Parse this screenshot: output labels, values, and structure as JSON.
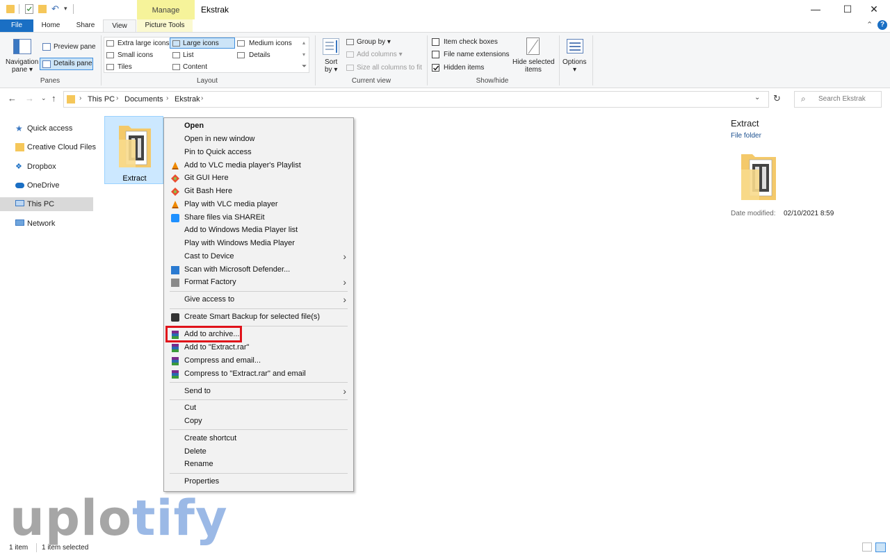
{
  "window": {
    "title": "Ekstrak",
    "context_tab": "Manage",
    "minimize": "—",
    "maximize": "☐",
    "close": "✕"
  },
  "tabs": {
    "file": "File",
    "home": "Home",
    "share": "Share",
    "view": "View",
    "picture_tools": "Picture Tools"
  },
  "ribbon": {
    "panes": {
      "navigation_pane": "Navigation",
      "navigation_pane_2": "pane ▾",
      "preview_pane": "Preview pane",
      "details_pane": "Details pane",
      "label": "Panes"
    },
    "layout": {
      "extra_large_icons": "Extra large icons",
      "large_icons": "Large icons",
      "medium_icons": "Medium icons",
      "small_icons": "Small icons",
      "list": "List",
      "details": "Details",
      "tiles": "Tiles",
      "content": "Content",
      "label": "Layout"
    },
    "current_view": {
      "sort_by": "Sort",
      "sort_by_2": "by ▾",
      "group_by": "Group by ▾",
      "add_columns": "Add columns ▾",
      "size_all_columns": "Size all columns to fit",
      "label": "Current view"
    },
    "show_hide": {
      "item_check_boxes": "Item check boxes",
      "file_name_extensions": "File name extensions",
      "hidden_items": "Hidden items",
      "hide_selected_items": "Hide selected",
      "hide_selected_items_2": "items",
      "label": "Show/hide"
    },
    "options": {
      "label": "Options",
      "arrow": "▾"
    }
  },
  "address": {
    "crumbs": [
      "This PC",
      "Documents",
      "Ekstrak"
    ],
    "search_placeholder": "Search Ekstrak"
  },
  "nav_pane": {
    "items": [
      "Quick access",
      "Creative Cloud Files",
      "Dropbox",
      "OneDrive",
      "This PC",
      "Network"
    ]
  },
  "file": {
    "name": "Extract"
  },
  "context_menu": {
    "items": [
      "Open",
      "Open in new window",
      "Pin to Quick access",
      "Add to VLC media player's Playlist",
      "Git GUI Here",
      "Git Bash Here",
      "Play with VLC media player",
      "Share files via SHAREit",
      "Add to Windows Media Player list",
      "Play with Windows Media Player",
      "Cast to Device",
      "Scan with Microsoft Defender...",
      "Format Factory",
      "Give access to",
      "Create Smart Backup for selected file(s)",
      "Add to archive...",
      "Add to \"Extract.rar\"",
      "Compress and email...",
      "Compress to \"Extract.rar\" and email",
      "Send to",
      "Cut",
      "Copy",
      "Create shortcut",
      "Delete",
      "Rename",
      "Properties"
    ]
  },
  "details_pane": {
    "name": "Extract",
    "type": "File folder",
    "date_label": "Date modified:",
    "date_value": "02/10/2021 8:59"
  },
  "watermark": {
    "part1": "uplo",
    "part2": "tify"
  },
  "status": {
    "count": "1 item",
    "selected": "1 item selected"
  },
  "colors": {
    "accent": "#1a6fc4",
    "selection": "#cce8ff",
    "highlight_box": "#e0121a"
  }
}
